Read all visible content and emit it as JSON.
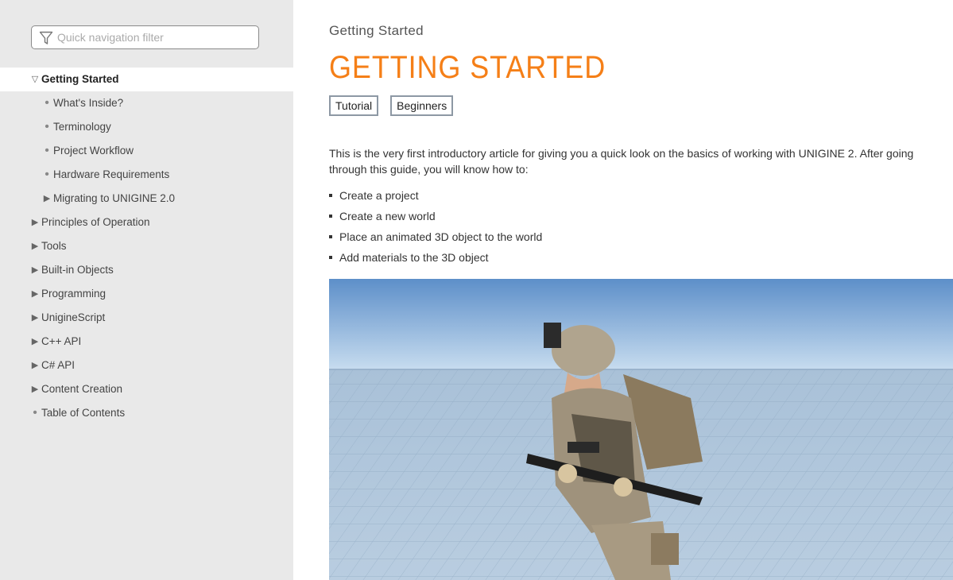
{
  "sidebar": {
    "filter_placeholder": "Quick navigation filter",
    "items": [
      {
        "label": "Getting Started",
        "marker": "▽",
        "active": true
      },
      {
        "label": "What's Inside?",
        "marker": "•"
      },
      {
        "label": "Terminology",
        "marker": "•"
      },
      {
        "label": "Project Workflow",
        "marker": "•"
      },
      {
        "label": "Hardware Requirements",
        "marker": "•"
      },
      {
        "label": "Migrating to UNIGINE 2.0",
        "marker": "▶"
      },
      {
        "label": "Principles of Operation",
        "marker": "▶"
      },
      {
        "label": "Tools",
        "marker": "▶"
      },
      {
        "label": "Built-in Objects",
        "marker": "▶"
      },
      {
        "label": "Programming",
        "marker": "▶"
      },
      {
        "label": "UnigineScript",
        "marker": "▶"
      },
      {
        "label": "C++ API",
        "marker": "▶"
      },
      {
        "label": "C# API",
        "marker": "▶"
      },
      {
        "label": "Content Creation",
        "marker": "▶"
      },
      {
        "label": "Table of Contents",
        "marker": "•"
      }
    ]
  },
  "main": {
    "breadcrumb": "Getting Started",
    "title": "GETTING STARTED",
    "tags": [
      "Tutorial",
      "Beginners"
    ],
    "intro": "This is the very first introductory article for giving you a quick look on the basics of working with UNIGINE 2. After going through this guide, you will know how to:",
    "bullets": [
      "Create a project",
      "Create a new world",
      "Place an animated 3D object to the world",
      "Add materials to the 3D object"
    ]
  },
  "colors": {
    "accent": "#f57f17",
    "sidebar_bg": "#e9e9e9",
    "tag_border": "#8d98a4"
  },
  "icons": {
    "filter": "funnel-icon"
  }
}
